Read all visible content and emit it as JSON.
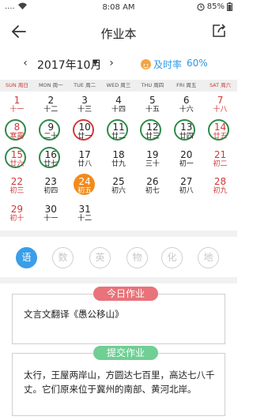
{
  "status_bar": {
    "signal": "....",
    "time": "8:08 AM",
    "battery": "85%"
  },
  "header": {
    "title": "作业本",
    "back_icon": "arrow-left-icon",
    "share_icon": "share-icon"
  },
  "month_bar": {
    "prev": "‹",
    "next": "›",
    "label": "2017年10月",
    "dropdown": "▼",
    "rate_label": "及时率",
    "rate_value": "60%",
    "colors": {
      "rate": "#2f98e6",
      "rate_icon": "#f2a443"
    }
  },
  "weekdays": [
    "SUN 周日",
    "MON 周一",
    "TUE 周二",
    "WED 周三",
    "THU 周四",
    "FRI 周五",
    "SAT 周六"
  ],
  "calendar": {
    "weeks": [
      [
        {
          "d": "1",
          "l": "十一",
          "red": true
        },
        {
          "d": "2",
          "l": "十二"
        },
        {
          "d": "3",
          "l": "十三"
        },
        {
          "d": "4",
          "l": "十四"
        },
        {
          "d": "5",
          "l": "十五"
        },
        {
          "d": "6",
          "l": "十六"
        },
        {
          "d": "7",
          "l": "十八",
          "red": true
        }
      ],
      [
        {
          "d": "8",
          "l": "寒露",
          "red": true,
          "mark": "green"
        },
        {
          "d": "9",
          "l": "二十",
          "mark": "green"
        },
        {
          "d": "10",
          "l": "廿一",
          "mark": "red"
        },
        {
          "d": "11",
          "l": "廿二",
          "mark": "green"
        },
        {
          "d": "12",
          "l": "廿三",
          "mark": "green"
        },
        {
          "d": "13",
          "l": "廿四",
          "mark": "green"
        },
        {
          "d": "14",
          "l": "廿五",
          "red": true,
          "mark": "green"
        }
      ],
      [
        {
          "d": "15",
          "l": "廿六",
          "red": true,
          "mark": "green"
        },
        {
          "d": "16",
          "l": "廿七",
          "mark": "green"
        },
        {
          "d": "17",
          "l": "廿八"
        },
        {
          "d": "18",
          "l": "廿九"
        },
        {
          "d": "19",
          "l": "三十"
        },
        {
          "d": "20",
          "l": "初一"
        },
        {
          "d": "21",
          "l": "初二",
          "red": true
        }
      ],
      [
        {
          "d": "22",
          "l": "初三",
          "red": true
        },
        {
          "d": "23",
          "l": "初四"
        },
        {
          "d": "24",
          "l": "初五",
          "today": true
        },
        {
          "d": "25",
          "l": "初六"
        },
        {
          "d": "26",
          "l": "初七"
        },
        {
          "d": "27",
          "l": "初八"
        },
        {
          "d": "28",
          "l": "初九",
          "red": true
        }
      ],
      [
        {
          "d": "29",
          "l": "初十",
          "red": true
        },
        {
          "d": "30",
          "l": "十一"
        },
        {
          "d": "31",
          "l": "十二"
        }
      ]
    ],
    "colors": {
      "weekend": "#d0393a",
      "done": "#2e8b47",
      "missed": "#d0393a",
      "today": "#f28b1d"
    }
  },
  "subjects": [
    {
      "label": "语",
      "active": true
    },
    {
      "label": "数"
    },
    {
      "label": "英"
    },
    {
      "label": "物"
    },
    {
      "label": "化"
    },
    {
      "label": "地"
    }
  ],
  "today_card": {
    "tag": "今日作业",
    "text": "文言文翻译《愚公移山》"
  },
  "submit_card": {
    "tag": "提交作业",
    "text": "太行，王屋两岸山，方圆达七百里，高达七八千丈。它们原来位于冀州的南部、黄河北岸。"
  }
}
